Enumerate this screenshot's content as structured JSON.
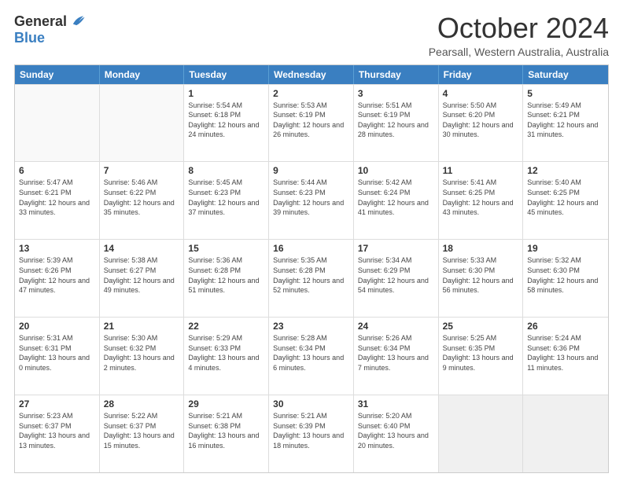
{
  "logo": {
    "general": "General",
    "blue": "Blue"
  },
  "header": {
    "month": "October 2024",
    "location": "Pearsall, Western Australia, Australia"
  },
  "weekdays": [
    "Sunday",
    "Monday",
    "Tuesday",
    "Wednesday",
    "Thursday",
    "Friday",
    "Saturday"
  ],
  "rows": [
    [
      {
        "day": "",
        "info": ""
      },
      {
        "day": "",
        "info": ""
      },
      {
        "day": "1",
        "info": "Sunrise: 5:54 AM\nSunset: 6:18 PM\nDaylight: 12 hours and 24 minutes."
      },
      {
        "day": "2",
        "info": "Sunrise: 5:53 AM\nSunset: 6:19 PM\nDaylight: 12 hours and 26 minutes."
      },
      {
        "day": "3",
        "info": "Sunrise: 5:51 AM\nSunset: 6:19 PM\nDaylight: 12 hours and 28 minutes."
      },
      {
        "day": "4",
        "info": "Sunrise: 5:50 AM\nSunset: 6:20 PM\nDaylight: 12 hours and 30 minutes."
      },
      {
        "day": "5",
        "info": "Sunrise: 5:49 AM\nSunset: 6:21 PM\nDaylight: 12 hours and 31 minutes."
      }
    ],
    [
      {
        "day": "6",
        "info": "Sunrise: 5:47 AM\nSunset: 6:21 PM\nDaylight: 12 hours and 33 minutes."
      },
      {
        "day": "7",
        "info": "Sunrise: 5:46 AM\nSunset: 6:22 PM\nDaylight: 12 hours and 35 minutes."
      },
      {
        "day": "8",
        "info": "Sunrise: 5:45 AM\nSunset: 6:23 PM\nDaylight: 12 hours and 37 minutes."
      },
      {
        "day": "9",
        "info": "Sunrise: 5:44 AM\nSunset: 6:23 PM\nDaylight: 12 hours and 39 minutes."
      },
      {
        "day": "10",
        "info": "Sunrise: 5:42 AM\nSunset: 6:24 PM\nDaylight: 12 hours and 41 minutes."
      },
      {
        "day": "11",
        "info": "Sunrise: 5:41 AM\nSunset: 6:25 PM\nDaylight: 12 hours and 43 minutes."
      },
      {
        "day": "12",
        "info": "Sunrise: 5:40 AM\nSunset: 6:25 PM\nDaylight: 12 hours and 45 minutes."
      }
    ],
    [
      {
        "day": "13",
        "info": "Sunrise: 5:39 AM\nSunset: 6:26 PM\nDaylight: 12 hours and 47 minutes."
      },
      {
        "day": "14",
        "info": "Sunrise: 5:38 AM\nSunset: 6:27 PM\nDaylight: 12 hours and 49 minutes."
      },
      {
        "day": "15",
        "info": "Sunrise: 5:36 AM\nSunset: 6:28 PM\nDaylight: 12 hours and 51 minutes."
      },
      {
        "day": "16",
        "info": "Sunrise: 5:35 AM\nSunset: 6:28 PM\nDaylight: 12 hours and 52 minutes."
      },
      {
        "day": "17",
        "info": "Sunrise: 5:34 AM\nSunset: 6:29 PM\nDaylight: 12 hours and 54 minutes."
      },
      {
        "day": "18",
        "info": "Sunrise: 5:33 AM\nSunset: 6:30 PM\nDaylight: 12 hours and 56 minutes."
      },
      {
        "day": "19",
        "info": "Sunrise: 5:32 AM\nSunset: 6:30 PM\nDaylight: 12 hours and 58 minutes."
      }
    ],
    [
      {
        "day": "20",
        "info": "Sunrise: 5:31 AM\nSunset: 6:31 PM\nDaylight: 13 hours and 0 minutes."
      },
      {
        "day": "21",
        "info": "Sunrise: 5:30 AM\nSunset: 6:32 PM\nDaylight: 13 hours and 2 minutes."
      },
      {
        "day": "22",
        "info": "Sunrise: 5:29 AM\nSunset: 6:33 PM\nDaylight: 13 hours and 4 minutes."
      },
      {
        "day": "23",
        "info": "Sunrise: 5:28 AM\nSunset: 6:34 PM\nDaylight: 13 hours and 6 minutes."
      },
      {
        "day": "24",
        "info": "Sunrise: 5:26 AM\nSunset: 6:34 PM\nDaylight: 13 hours and 7 minutes."
      },
      {
        "day": "25",
        "info": "Sunrise: 5:25 AM\nSunset: 6:35 PM\nDaylight: 13 hours and 9 minutes."
      },
      {
        "day": "26",
        "info": "Sunrise: 5:24 AM\nSunset: 6:36 PM\nDaylight: 13 hours and 11 minutes."
      }
    ],
    [
      {
        "day": "27",
        "info": "Sunrise: 5:23 AM\nSunset: 6:37 PM\nDaylight: 13 hours and 13 minutes."
      },
      {
        "day": "28",
        "info": "Sunrise: 5:22 AM\nSunset: 6:37 PM\nDaylight: 13 hours and 15 minutes."
      },
      {
        "day": "29",
        "info": "Sunrise: 5:21 AM\nSunset: 6:38 PM\nDaylight: 13 hours and 16 minutes."
      },
      {
        "day": "30",
        "info": "Sunrise: 5:21 AM\nSunset: 6:39 PM\nDaylight: 13 hours and 18 minutes."
      },
      {
        "day": "31",
        "info": "Sunrise: 5:20 AM\nSunset: 6:40 PM\nDaylight: 13 hours and 20 minutes."
      },
      {
        "day": "",
        "info": ""
      },
      {
        "day": "",
        "info": ""
      }
    ]
  ]
}
